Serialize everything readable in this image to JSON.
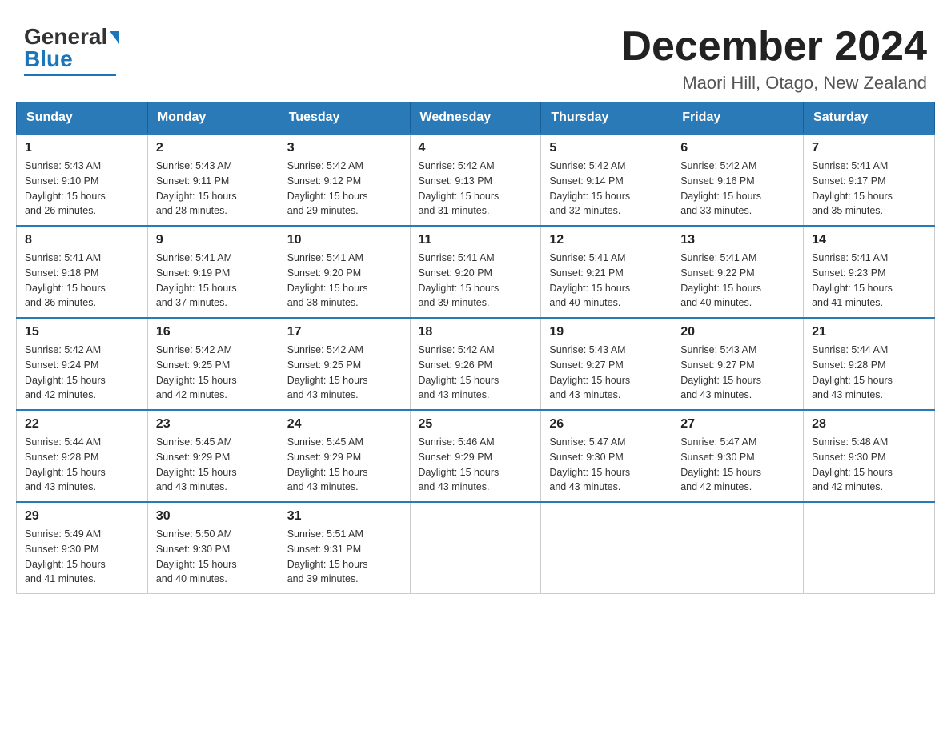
{
  "header": {
    "logo_general": "General",
    "logo_blue": "Blue",
    "month_title": "December 2024",
    "location": "Maori Hill, Otago, New Zealand"
  },
  "weekdays": [
    "Sunday",
    "Monday",
    "Tuesday",
    "Wednesday",
    "Thursday",
    "Friday",
    "Saturday"
  ],
  "weeks": [
    [
      {
        "day": "1",
        "sunrise": "5:43 AM",
        "sunset": "9:10 PM",
        "daylight": "15 hours and 26 minutes."
      },
      {
        "day": "2",
        "sunrise": "5:43 AM",
        "sunset": "9:11 PM",
        "daylight": "15 hours and 28 minutes."
      },
      {
        "day": "3",
        "sunrise": "5:42 AM",
        "sunset": "9:12 PM",
        "daylight": "15 hours and 29 minutes."
      },
      {
        "day": "4",
        "sunrise": "5:42 AM",
        "sunset": "9:13 PM",
        "daylight": "15 hours and 31 minutes."
      },
      {
        "day": "5",
        "sunrise": "5:42 AM",
        "sunset": "9:14 PM",
        "daylight": "15 hours and 32 minutes."
      },
      {
        "day": "6",
        "sunrise": "5:42 AM",
        "sunset": "9:16 PM",
        "daylight": "15 hours and 33 minutes."
      },
      {
        "day": "7",
        "sunrise": "5:41 AM",
        "sunset": "9:17 PM",
        "daylight": "15 hours and 35 minutes."
      }
    ],
    [
      {
        "day": "8",
        "sunrise": "5:41 AM",
        "sunset": "9:18 PM",
        "daylight": "15 hours and 36 minutes."
      },
      {
        "day": "9",
        "sunrise": "5:41 AM",
        "sunset": "9:19 PM",
        "daylight": "15 hours and 37 minutes."
      },
      {
        "day": "10",
        "sunrise": "5:41 AM",
        "sunset": "9:20 PM",
        "daylight": "15 hours and 38 minutes."
      },
      {
        "day": "11",
        "sunrise": "5:41 AM",
        "sunset": "9:20 PM",
        "daylight": "15 hours and 39 minutes."
      },
      {
        "day": "12",
        "sunrise": "5:41 AM",
        "sunset": "9:21 PM",
        "daylight": "15 hours and 40 minutes."
      },
      {
        "day": "13",
        "sunrise": "5:41 AM",
        "sunset": "9:22 PM",
        "daylight": "15 hours and 40 minutes."
      },
      {
        "day": "14",
        "sunrise": "5:41 AM",
        "sunset": "9:23 PM",
        "daylight": "15 hours and 41 minutes."
      }
    ],
    [
      {
        "day": "15",
        "sunrise": "5:42 AM",
        "sunset": "9:24 PM",
        "daylight": "15 hours and 42 minutes."
      },
      {
        "day": "16",
        "sunrise": "5:42 AM",
        "sunset": "9:25 PM",
        "daylight": "15 hours and 42 minutes."
      },
      {
        "day": "17",
        "sunrise": "5:42 AM",
        "sunset": "9:25 PM",
        "daylight": "15 hours and 43 minutes."
      },
      {
        "day": "18",
        "sunrise": "5:42 AM",
        "sunset": "9:26 PM",
        "daylight": "15 hours and 43 minutes."
      },
      {
        "day": "19",
        "sunrise": "5:43 AM",
        "sunset": "9:27 PM",
        "daylight": "15 hours and 43 minutes."
      },
      {
        "day": "20",
        "sunrise": "5:43 AM",
        "sunset": "9:27 PM",
        "daylight": "15 hours and 43 minutes."
      },
      {
        "day": "21",
        "sunrise": "5:44 AM",
        "sunset": "9:28 PM",
        "daylight": "15 hours and 43 minutes."
      }
    ],
    [
      {
        "day": "22",
        "sunrise": "5:44 AM",
        "sunset": "9:28 PM",
        "daylight": "15 hours and 43 minutes."
      },
      {
        "day": "23",
        "sunrise": "5:45 AM",
        "sunset": "9:29 PM",
        "daylight": "15 hours and 43 minutes."
      },
      {
        "day": "24",
        "sunrise": "5:45 AM",
        "sunset": "9:29 PM",
        "daylight": "15 hours and 43 minutes."
      },
      {
        "day": "25",
        "sunrise": "5:46 AM",
        "sunset": "9:29 PM",
        "daylight": "15 hours and 43 minutes."
      },
      {
        "day": "26",
        "sunrise": "5:47 AM",
        "sunset": "9:30 PM",
        "daylight": "15 hours and 43 minutes."
      },
      {
        "day": "27",
        "sunrise": "5:47 AM",
        "sunset": "9:30 PM",
        "daylight": "15 hours and 42 minutes."
      },
      {
        "day": "28",
        "sunrise": "5:48 AM",
        "sunset": "9:30 PM",
        "daylight": "15 hours and 42 minutes."
      }
    ],
    [
      {
        "day": "29",
        "sunrise": "5:49 AM",
        "sunset": "9:30 PM",
        "daylight": "15 hours and 41 minutes."
      },
      {
        "day": "30",
        "sunrise": "5:50 AM",
        "sunset": "9:30 PM",
        "daylight": "15 hours and 40 minutes."
      },
      {
        "day": "31",
        "sunrise": "5:51 AM",
        "sunset": "9:31 PM",
        "daylight": "15 hours and 39 minutes."
      },
      null,
      null,
      null,
      null
    ]
  ],
  "labels": {
    "sunrise": "Sunrise:",
    "sunset": "Sunset:",
    "daylight": "Daylight:"
  }
}
